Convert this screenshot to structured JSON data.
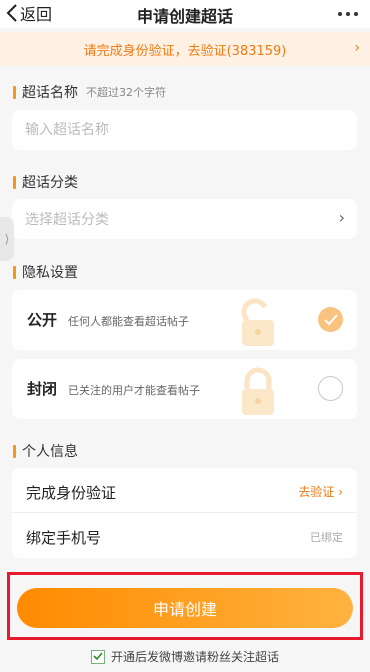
{
  "header": {
    "back_label": "返回",
    "title": "申请创建超话"
  },
  "notice": {
    "text": "请完成身份验证，去验证(383159)",
    "arrow": "›"
  },
  "name_section": {
    "label": "超话名称",
    "hint": "不超过32个字符",
    "placeholder": "输入超话名称"
  },
  "category_section": {
    "label": "超话分类",
    "placeholder": "选择超话分类",
    "chevron": "›"
  },
  "side_tab": {
    "glyph": "⟩"
  },
  "privacy_section": {
    "label": "隐私设置",
    "options": [
      {
        "name": "公开",
        "desc": "任何人都能查看超话帖子",
        "selected": true,
        "icon": "unlocked-padlock-icon"
      },
      {
        "name": "封闭",
        "desc": "已关注的用户才能查看帖子",
        "selected": false,
        "icon": "locked-padlock-icon"
      }
    ]
  },
  "personal_section": {
    "label": "个人信息",
    "rows": [
      {
        "label": "完成身份验证",
        "action": "去验证 ›"
      },
      {
        "label": "绑定手机号",
        "status": "已绑定"
      }
    ]
  },
  "submit": {
    "label": "申请创建"
  },
  "agreement": {
    "checked": true,
    "text": "开通后发微博邀请粉丝关注超话"
  },
  "colors": {
    "accent": "#f7931e",
    "highlight_frame": "#e8192c"
  }
}
